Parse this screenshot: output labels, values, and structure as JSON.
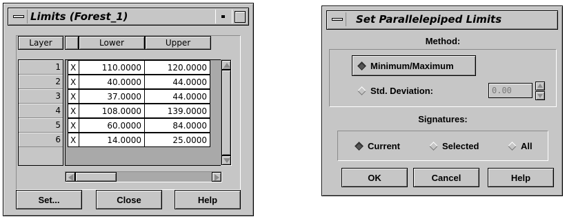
{
  "limits_window": {
    "title": "Limits (Forest_1)",
    "columns": {
      "layer": "Layer",
      "lower": "Lower",
      "upper": "Upper"
    },
    "rows": [
      {
        "layer": "1",
        "check": "X",
        "lower": "110.0000",
        "upper": "120.0000"
      },
      {
        "layer": "2",
        "check": "X",
        "lower": "40.0000",
        "upper": "44.0000"
      },
      {
        "layer": "3",
        "check": "X",
        "lower": "37.0000",
        "upper": "44.0000"
      },
      {
        "layer": "4",
        "check": "X",
        "lower": "108.0000",
        "upper": "139.0000"
      },
      {
        "layer": "5",
        "check": "X",
        "lower": "60.0000",
        "upper": "84.0000"
      },
      {
        "layer": "6",
        "check": "X",
        "lower": "14.0000",
        "upper": "25.0000"
      }
    ],
    "buttons": {
      "set": "Set...",
      "close": "Close",
      "help": "Help"
    }
  },
  "parallelepiped_window": {
    "title": "Set Parallelepiped Limits",
    "method_label": "Method:",
    "method_options": {
      "minmax": "Minimum/Maximum",
      "stddev": "Std. Deviation:"
    },
    "method_selected": "minmax",
    "stddev_value": "0.00",
    "signatures_label": "Signatures:",
    "signature_options": {
      "current": "Current",
      "selected": "Selected",
      "all": "All"
    },
    "signature_selected": "current",
    "buttons": {
      "ok": "OK",
      "cancel": "Cancel",
      "help": "Help"
    }
  }
}
